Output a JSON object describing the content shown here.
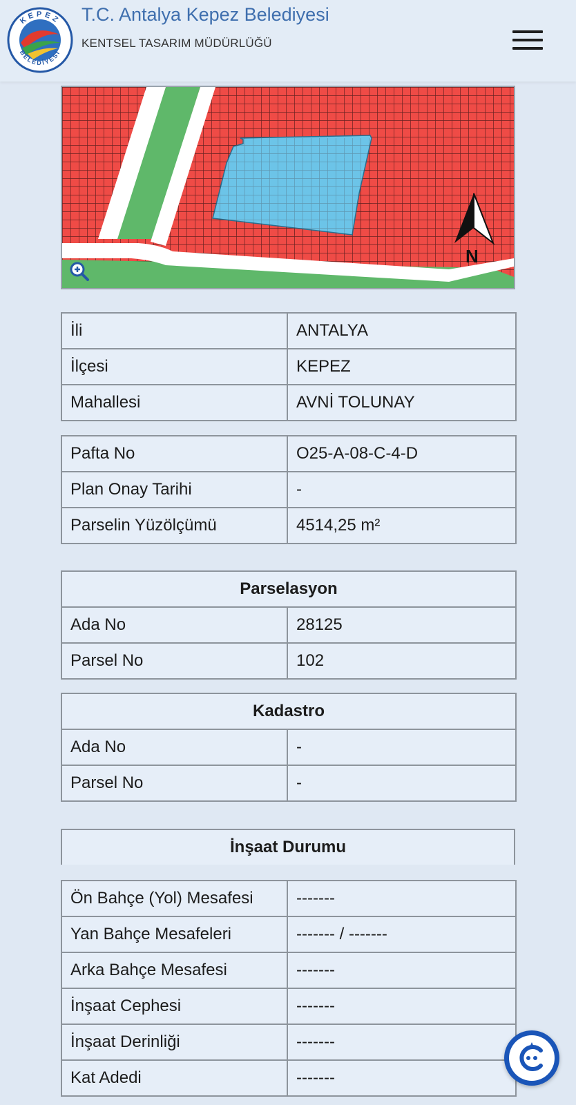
{
  "header": {
    "title": "T.C. Antalya Kepez Belediyesi",
    "subtitle": "KENTSEL TASARIM MÜDÜRLÜĞÜ",
    "logo_top": "KEPEZ",
    "logo_bottom": "BELEDİYESİ"
  },
  "map": {
    "north_label": "N",
    "zoom_icon": "zoom-in-icon",
    "colors": {
      "zone": "#ef4b46",
      "parcel": "#6cc4e8",
      "green": "#5fb86a",
      "road": "#ffffff"
    }
  },
  "location": {
    "rows": [
      {
        "label": "İli",
        "value": "ANTALYA"
      },
      {
        "label": "İlçesi",
        "value": "KEPEZ"
      },
      {
        "label": "Mahallesi",
        "value": "AVNİ TOLUNAY"
      }
    ]
  },
  "plan": {
    "rows": [
      {
        "label": "Pafta No",
        "value": "O25-A-08-C-4-D"
      },
      {
        "label": "Plan Onay Tarihi",
        "value": "-"
      },
      {
        "label": "Parselin Yüzölçümü",
        "value": "4514,25 m²"
      }
    ]
  },
  "parselasyon": {
    "title": "Parselasyon",
    "rows": [
      {
        "label": "Ada No",
        "value": "28125"
      },
      {
        "label": "Parsel No",
        "value": "102"
      }
    ]
  },
  "kadastro": {
    "title": "Kadastro",
    "rows": [
      {
        "label": "Ada No",
        "value": "-"
      },
      {
        "label": "Parsel No",
        "value": "-"
      }
    ]
  },
  "insaat": {
    "title": "İnşaat Durumu",
    "rows": [
      {
        "label": "Ön Bahçe (Yol) Mesafesi",
        "value": "-------"
      },
      {
        "label": "Yan Bahçe Mesafeleri",
        "value": "------- / -------"
      },
      {
        "label": "Arka Bahçe Mesafesi",
        "value": "-------"
      },
      {
        "label": "İnşaat Cephesi",
        "value": "-------"
      },
      {
        "label": "İnşaat Derinliği",
        "value": "-------"
      },
      {
        "label": "Kat Adedi",
        "value": "-------"
      }
    ]
  },
  "chat": {
    "icon": "chat-assistant-icon"
  }
}
